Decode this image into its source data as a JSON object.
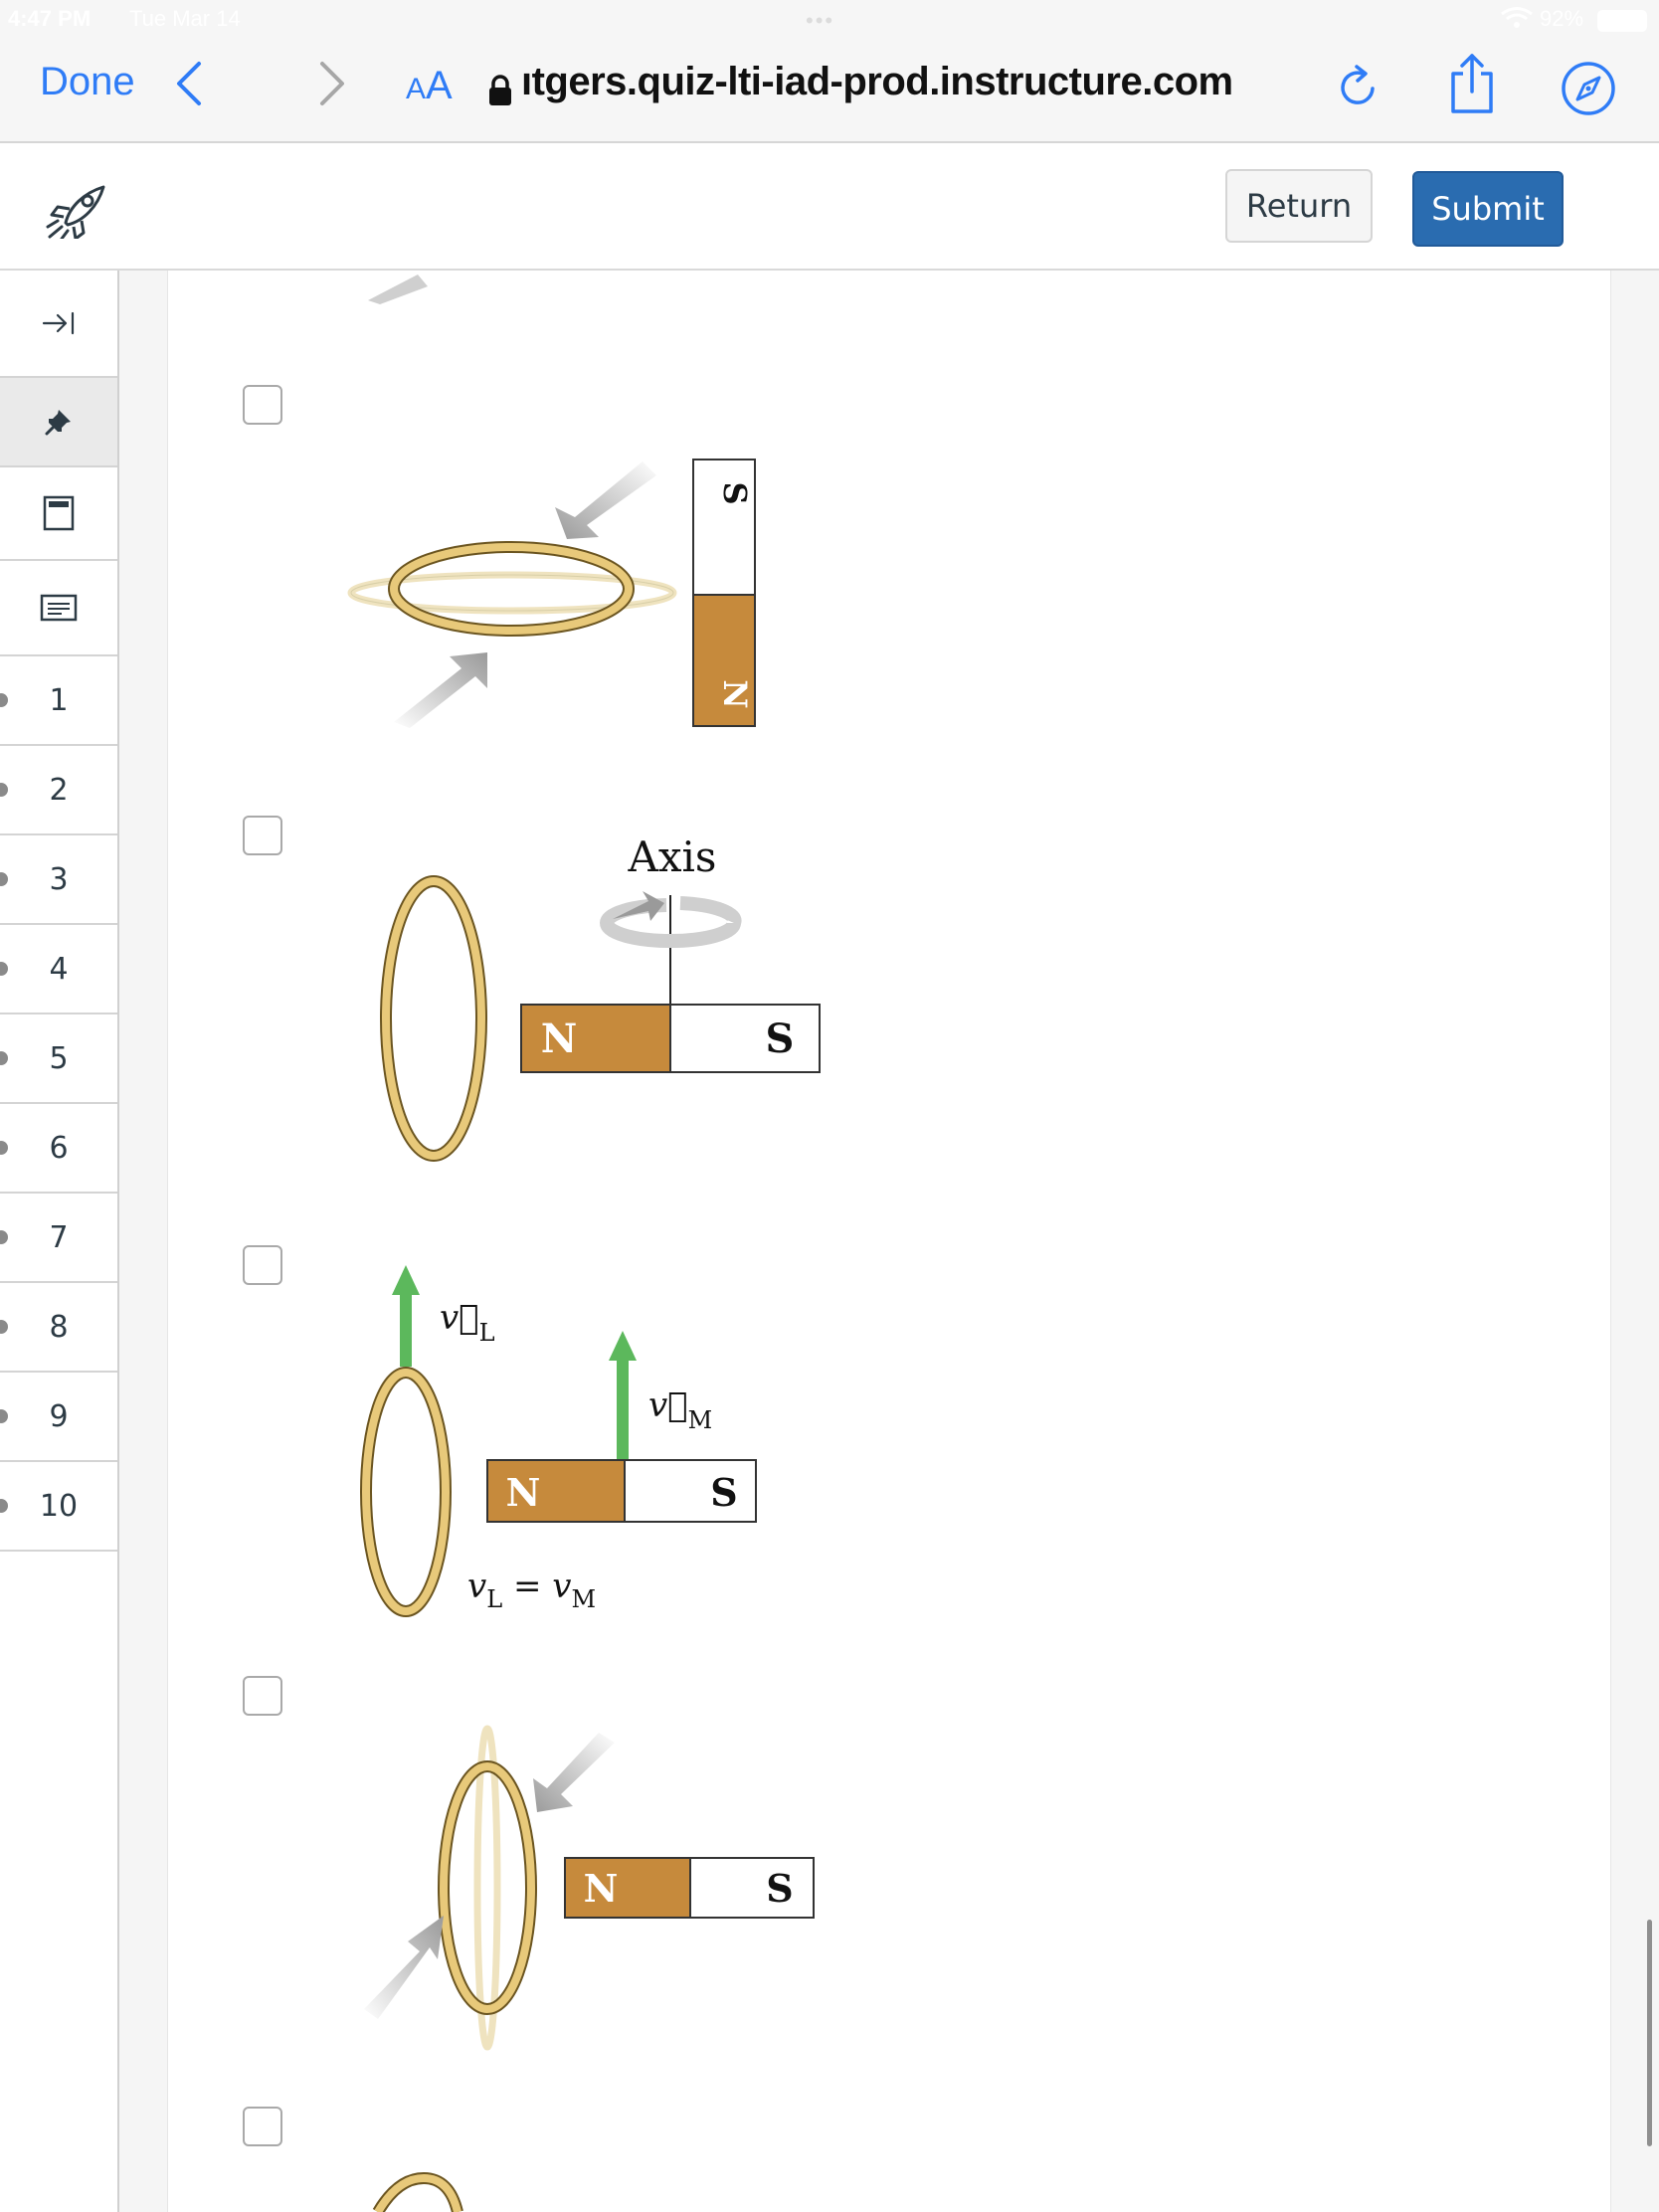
{
  "status_bar": {
    "time": "4:47 PM",
    "date": "Tue Mar 14",
    "battery": "92%"
  },
  "browser": {
    "done_label": "Done",
    "text_size_small": "A",
    "text_size_large": "A",
    "url": "ıtgers.quiz-lti-iad-prod.instructure.com"
  },
  "header": {
    "return_label": "Return",
    "submit_label": "Submit"
  },
  "sidebar": {
    "questions": [
      "1",
      "2",
      "3",
      "4",
      "5",
      "6",
      "7",
      "8",
      "9",
      "10"
    ]
  },
  "options": {
    "option_a": {
      "magnet_top": "S",
      "magnet_bottom": "N"
    },
    "option_b": {
      "axis_label": "Axis",
      "magnet_left": "N",
      "magnet_right": "S"
    },
    "option_c": {
      "vel_loop": "v⃗",
      "vel_loop_sub": "L",
      "vel_magnet": "v⃗",
      "vel_magnet_sub": "M",
      "magnet_left": "N",
      "magnet_right": "S",
      "equation_v1": "v",
      "equation_v1_sub": "L",
      "equation_eq": " = ",
      "equation_v2": "v",
      "equation_v2_sub": "M"
    },
    "option_d": {
      "magnet_left": "N",
      "magnet_right": "S"
    }
  },
  "colors": {
    "accent": "#2a6cb0",
    "ios_blue": "#2f7cf6",
    "magnet_north": "#c68a3c",
    "ring_gold": "#e8c97a",
    "arrow_gray": "#9a9a9a",
    "velocity_green": "#5cb85c"
  },
  "icons": {
    "app": "rocket-icon",
    "collapse": "collapse-sidebar-icon",
    "pin": "pin-icon",
    "calculator": "calculator-icon",
    "notes": "notes-icon"
  }
}
